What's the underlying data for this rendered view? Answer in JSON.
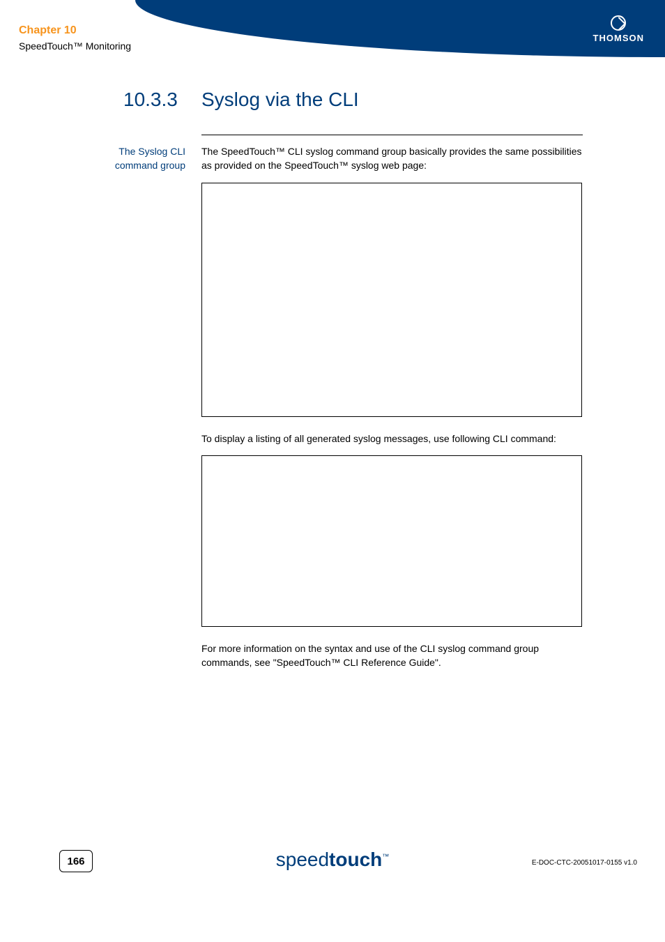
{
  "header": {
    "chapter_label": "Chapter 10",
    "chapter_subtitle": "SpeedTouch™ Monitoring",
    "brand": "THOMSON"
  },
  "section": {
    "number": "10.3.3",
    "title": "Syslog via the CLI"
  },
  "sidebar": {
    "label": "The Syslog CLI command group"
  },
  "body": {
    "paragraph_1": "The SpeedTouch™ CLI syslog command group basically provides the same possibilities as provided on the SpeedTouch™ syslog web page:",
    "paragraph_2": "To display a listing of all generated syslog messages, use following CLI command:",
    "paragraph_3": "For more information on the syntax and use of the CLI syslog command group commands, see \"SpeedTouch™ CLI Reference Guide\"."
  },
  "footer": {
    "page_number": "166",
    "logo_light": "speed",
    "logo_bold": "touch",
    "logo_tm": "™",
    "doc_id": "E-DOC-CTC-20051017-0155 v1.0"
  }
}
